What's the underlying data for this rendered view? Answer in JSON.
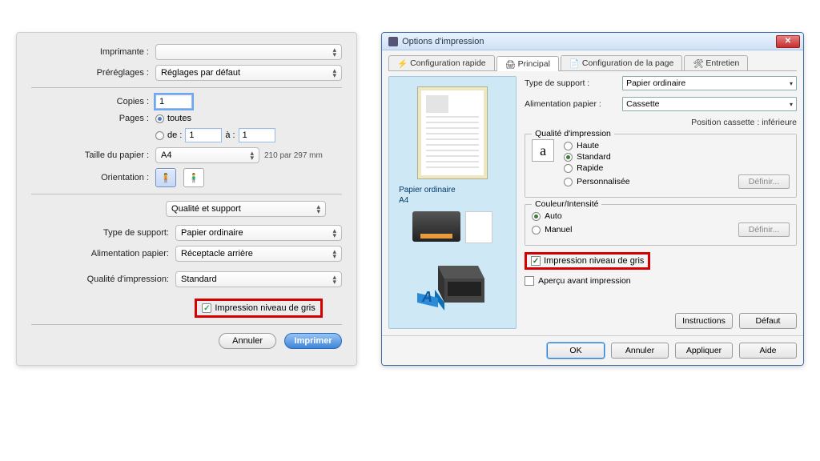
{
  "mac": {
    "labels": {
      "printer": "Imprimante :",
      "presets": "Préréglages :",
      "copies": "Copies :",
      "pages": "Pages :",
      "paper_size": "Taille du papier :",
      "orientation": "Orientation :",
      "media_type": "Type de support:",
      "paper_feed": "Alimentation papier:",
      "print_quality": "Qualité d'impression:"
    },
    "presets_value": "Réglages par défaut",
    "copies_value": "1",
    "pages_all": "toutes",
    "pages_from": "de :",
    "pages_from_value": "1",
    "pages_to": "à :",
    "pages_to_value": "1",
    "paper_size_value": "A4",
    "paper_size_info": "210 par 297 mm",
    "section": "Qualité et support",
    "media_type_value": "Papier ordinaire",
    "paper_feed_value": "Réceptacle arrière",
    "print_quality_value": "Standard",
    "greyscale_label": "Impression niveau de gris",
    "cancel": "Annuler",
    "print": "Imprimer"
  },
  "win": {
    "title": "Options d'impression",
    "tabs": {
      "quick": "Configuration rapide",
      "main": "Principal",
      "page": "Configuration de la page",
      "maint": "Entretien"
    },
    "labels": {
      "media_type": "Type de support :",
      "paper_feed": "Alimentation papier :"
    },
    "media_type_value": "Papier ordinaire",
    "paper_feed_value": "Cassette",
    "cassette_pos": "Position cassette : inférieure",
    "quality_legend": "Qualité d'impression",
    "quality": {
      "high": "Haute",
      "standard": "Standard",
      "fast": "Rapide",
      "custom": "Personnalisée"
    },
    "color_legend": "Couleur/Intensité",
    "color": {
      "auto": "Auto",
      "manual": "Manuel"
    },
    "define_btn": "Définir...",
    "greyscale_label": "Impression niveau de gris",
    "preview_checkbox": "Aperçu avant impression",
    "preview": {
      "paper": "Papier ordinaire",
      "size": "A4"
    },
    "instructions": "Instructions",
    "default": "Défaut",
    "buttons": {
      "ok": "OK",
      "cancel": "Annuler",
      "apply": "Appliquer",
      "help": "Aide"
    }
  }
}
